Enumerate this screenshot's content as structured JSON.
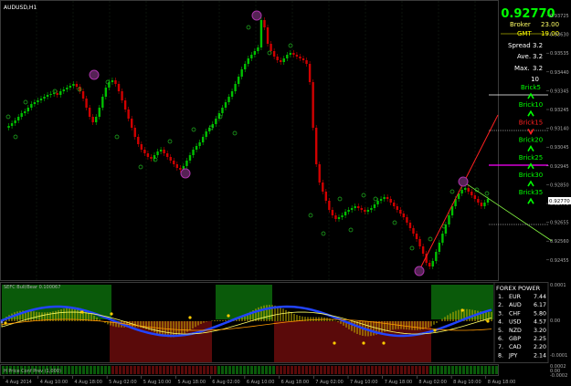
{
  "window": {
    "symbol_title": "AUDUSD,H1"
  },
  "info_panel": {
    "price": "0.92770",
    "broker_label": "Broker",
    "broker_value": "23.00",
    "gmt_label": "GMT",
    "gmt_value": "19.00",
    "spread_label": "Spread",
    "spread_value": "3.2",
    "ave_label": "Ave.",
    "ave_value": "3.2",
    "max_label": "Max.",
    "max_value": "3.2",
    "count_value": "10"
  },
  "bricks": [
    {
      "label": "Brick5",
      "arrow": "up"
    },
    {
      "label": "Brick10",
      "arrow": "up"
    },
    {
      "label": "Brick15",
      "arrow": "down"
    },
    {
      "label": "Brick20",
      "arrow": "up"
    },
    {
      "label": "Brick25",
      "arrow": "up"
    },
    {
      "label": "Brick30",
      "arrow": "up"
    },
    {
      "label": "Brick35",
      "arrow": "up"
    }
  ],
  "price_axis": {
    "labels": [
      "0.93725",
      "0.93630",
      "0.93535",
      "0.93440",
      "0.93345",
      "0.93245",
      "0.93140",
      "0.93045",
      "0.92945",
      "0.92850",
      "0.92770",
      "0.92655",
      "0.92560",
      "0.92455"
    ],
    "current_label": "0.92770"
  },
  "indicator1": {
    "title": "SEFC Bull/Bear 0.100067"
  },
  "indicator2": {
    "title": "H Price Conf Prev (1,000)"
  },
  "forex_power": {
    "title": "FOREX POWER",
    "rows": [
      {
        "rank": "1.",
        "currency": "EUR",
        "value": "7.44"
      },
      {
        "rank": "2.",
        "currency": "AUD",
        "value": "6.17"
      },
      {
        "rank": "3.",
        "currency": "CHF",
        "value": "5.80"
      },
      {
        "rank": "4.",
        "currency": "USD",
        "value": "4.57"
      },
      {
        "rank": "5.",
        "currency": "NZD",
        "value": "3.20"
      },
      {
        "rank": "6.",
        "currency": "GBP",
        "value": "2.25"
      },
      {
        "rank": "7.",
        "currency": "CAD",
        "value": "2.20"
      },
      {
        "rank": "8.",
        "currency": "JPY",
        "value": "2.14"
      }
    ]
  },
  "sub_axis": {
    "labels": [
      "0.0001",
      "0.00",
      "-0.0001",
      "0.0002",
      "0.00",
      "-0.0002"
    ]
  },
  "time_axis": {
    "labels": [
      "4 Aug 2014",
      "4 Aug 10:00",
      "4 Aug 18:00",
      "5 Aug 02:00",
      "5 Aug 10:00",
      "5 Aug 18:00",
      "6 Aug 02:00",
      "6 Aug 10:00",
      "6 Aug 18:00",
      "7 Aug 02:00",
      "7 Aug 10:00",
      "7 Aug 18:00",
      "8 Aug 02:00",
      "8 Aug 10:00",
      "8 Aug 18:00"
    ]
  },
  "colors": {
    "bull": "#00c000",
    "bear": "#d00000",
    "panel_border": "#3a3a3a",
    "accent_price": "#00ff00",
    "broker": "#ffff66",
    "gmt": "#ffff00",
    "magenta": "#ff00ff",
    "red_line": "#ff2020",
    "green_line": "#88ff44"
  }
}
